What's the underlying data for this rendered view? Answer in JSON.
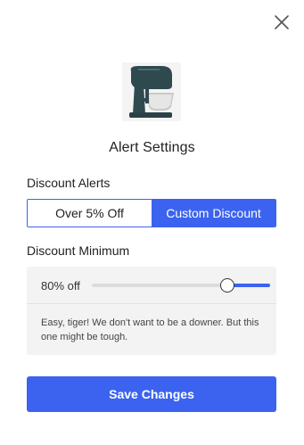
{
  "header": {
    "close_icon": "close-icon"
  },
  "product": {
    "image_icon": "stand-mixer-image"
  },
  "title": "Alert Settings",
  "discount_alerts": {
    "label": "Discount Alerts",
    "options": [
      "Over 5% Off",
      "Custom Discount"
    ],
    "selected": "Custom Discount"
  },
  "discount_minimum": {
    "label": "Discount Minimum",
    "value_text": "80% off",
    "value_percent": 80,
    "message": "Easy, tiger! We don't want to be a downer. But this one might be tough."
  },
  "save_button": {
    "label": "Save Changes"
  },
  "colors": {
    "accent": "#3b63f0",
    "panel_bg": "#f3f3f3",
    "track": "#dcdcdc"
  }
}
